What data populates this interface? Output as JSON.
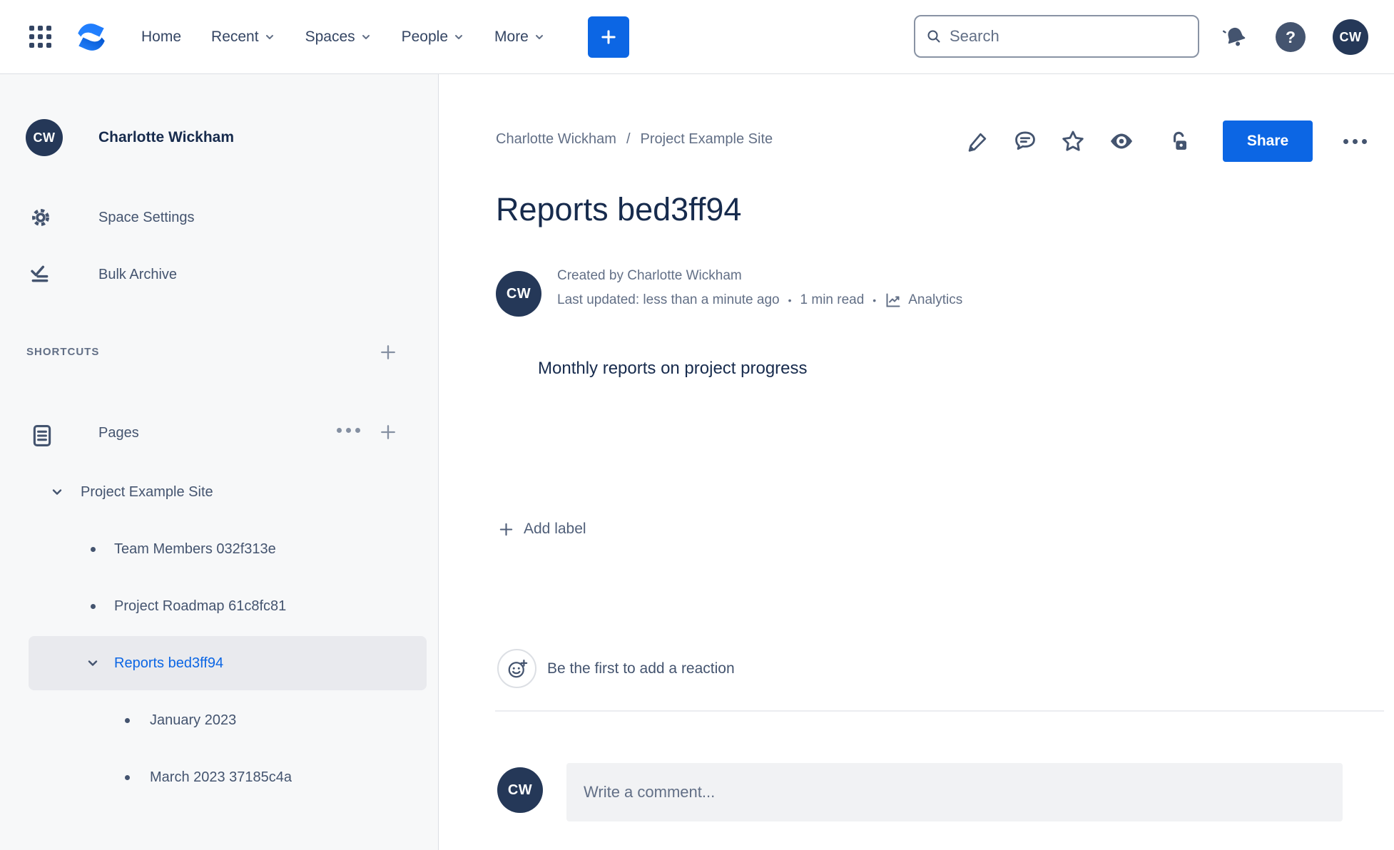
{
  "colors": {
    "accent_blue": "#0C66E4",
    "logo_blue_light": "#2684FF",
    "logo_blue_dark": "#0052CC",
    "avatar_navy": "#253858",
    "text_primary": "#172B4D",
    "text_secondary": "#626F86",
    "icon_slate": "#44546F",
    "sidebar_bg": "#F7F8F9",
    "selected_row_bg": "#E9EAEE",
    "border": "#DCDFE4"
  },
  "icons": {
    "app_switcher": "grid-dots",
    "logo": "confluence-mark",
    "nav_chevron": "chevron-down",
    "create": "plus",
    "search": "magnifier",
    "notifications": "bell",
    "help": "question-circle",
    "space_settings": "gear",
    "bulk_archive": "check-list",
    "pages": "document",
    "edit": "pencil",
    "comments": "speech-bubble",
    "favorite": "star",
    "watch": "eye",
    "restrictions": "unlocked-padlock",
    "analytics": "line-chart",
    "reaction": "smiley-plus"
  },
  "top_nav": {
    "nav_items": [
      {
        "label": "Home",
        "chevron": false
      },
      {
        "label": "Recent",
        "chevron": true
      },
      {
        "label": "Spaces",
        "chevron": true
      },
      {
        "label": "People",
        "chevron": true
      },
      {
        "label": "More",
        "chevron": true
      }
    ],
    "search": {
      "placeholder": "Search"
    },
    "avatar_initials": "CW"
  },
  "sidebar": {
    "profile": {
      "initials": "CW",
      "name": "Charlotte Wickham"
    },
    "menu": [
      {
        "label": "Space Settings"
      },
      {
        "label": "Bulk Archive"
      }
    ],
    "shortcuts_header": "SHORTCUTS",
    "pages_label": "Pages",
    "tree": [
      {
        "label": "Project Example Site",
        "level": 0,
        "marker": "chevron",
        "selected": false
      },
      {
        "label": "Team Members 032f313e",
        "level": 1,
        "marker": "bullet",
        "selected": false
      },
      {
        "label": "Project Roadmap 61c8fc81",
        "level": 1,
        "marker": "bullet",
        "selected": false
      },
      {
        "label": "Reports bed3ff94",
        "level": 1,
        "marker": "chevron",
        "selected": true
      },
      {
        "label": "January 2023",
        "level": 2,
        "marker": "bullet",
        "selected": false
      },
      {
        "label": "March 2023 37185c4a",
        "level": 2,
        "marker": "bullet",
        "selected": false
      }
    ]
  },
  "main": {
    "breadcrumb": {
      "items": [
        "Charlotte Wickham",
        "Project Example Site"
      ],
      "separator": "/"
    },
    "actions": {
      "share_label": "Share"
    },
    "title": "Reports bed3ff94",
    "byline": {
      "initials": "CW",
      "created": "Created by Charlotte Wickham",
      "updated": "Last updated: less than a minute ago",
      "read_time": "1 min read",
      "analytics_label": "Analytics",
      "separator": "•"
    },
    "body_text": "Monthly reports on project progress",
    "add_label": "Add label",
    "reactions_text": "Be the first to add a reaction",
    "comment": {
      "initials": "CW",
      "placeholder": "Write a comment..."
    }
  }
}
